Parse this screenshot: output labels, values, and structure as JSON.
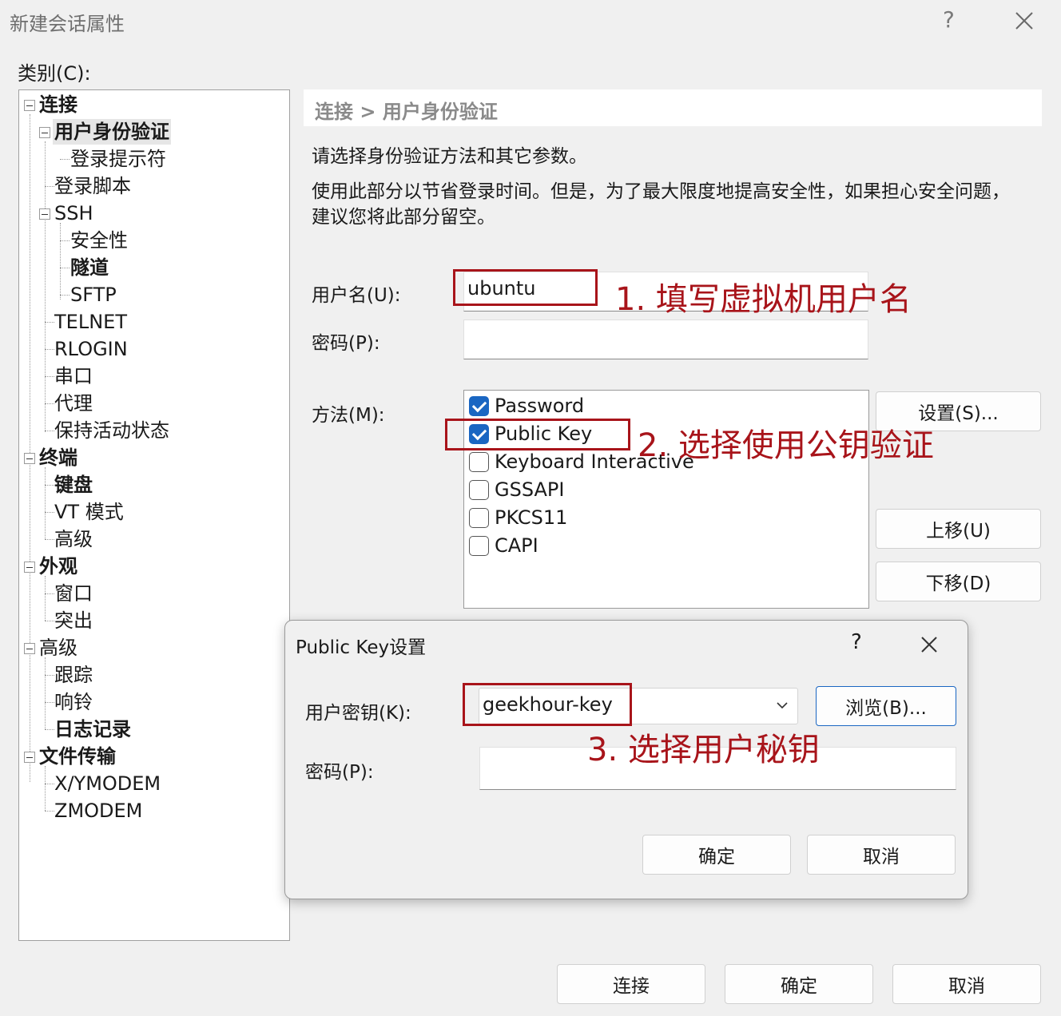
{
  "window": {
    "title": "新建会话属性",
    "help": "?"
  },
  "category_label": "类别(C):",
  "tree": {
    "connection": "连接",
    "user_auth": "用户身份验证",
    "login_prompt": "登录提示符",
    "login_script": "登录脚本",
    "ssh": "SSH",
    "security": "安全性",
    "tunnel": "隧道",
    "sftp": "SFTP",
    "telnet": "TELNET",
    "rlogin": "RLOGIN",
    "serial": "串口",
    "proxy": "代理",
    "keepalive": "保持活动状态",
    "terminal": "终端",
    "keyboard": "键盘",
    "vt_mode": "VT 模式",
    "terminal_advanced": "高级",
    "appearance": "外观",
    "window": "窗口",
    "highlight": "突出",
    "advanced": "高级",
    "trace": "跟踪",
    "bell": "响铃",
    "logging": "日志记录",
    "file_transfer": "文件传输",
    "xymodem": "X/YMODEM",
    "zmodem": "ZMODEM"
  },
  "breadcrumb": "连接 > 用户身份验证",
  "desc1": "请选择身份验证方法和其它参数。",
  "desc2_line1": "使用此部分以节省登录时间。但是，为了最大限度地提高安全性，如果担心安全问题，",
  "desc2_line2": "建议您将此部分留空。",
  "username": {
    "label": "用户名(U):",
    "value": "ubuntu"
  },
  "password": {
    "label": "密码(P):",
    "value": ""
  },
  "method": {
    "label": "方法(M):",
    "items": [
      {
        "label": "Password",
        "checked": true
      },
      {
        "label": "Public Key",
        "checked": true
      },
      {
        "label": "Keyboard Interactive",
        "checked": false
      },
      {
        "label": "GSSAPI",
        "checked": false
      },
      {
        "label": "PKCS11",
        "checked": false
      },
      {
        "label": "CAPI",
        "checked": false
      }
    ]
  },
  "buttons": {
    "settings": "设置(S)...",
    "move_up": "上移(U)",
    "move_down": "下移(D)",
    "connect": "连接",
    "ok": "确定",
    "cancel": "取消"
  },
  "annotations": {
    "step1": "1. 填写虚拟机用户名",
    "step2": "2. 选择使用公钥验证",
    "step3": "3. 选择用户秘钥"
  },
  "pubkey_dialog": {
    "title": "Public Key设置",
    "help": "?",
    "user_key_label": "用户密钥(K):",
    "user_key_value": "geekhour-key",
    "browse": "浏览(B)...",
    "passphrase_label": "密码(P):",
    "passphrase_value": "",
    "ok": "确定",
    "cancel": "取消"
  },
  "colors": {
    "annotation_red": "#a8141a",
    "checkbox_blue": "#1a66c2"
  }
}
